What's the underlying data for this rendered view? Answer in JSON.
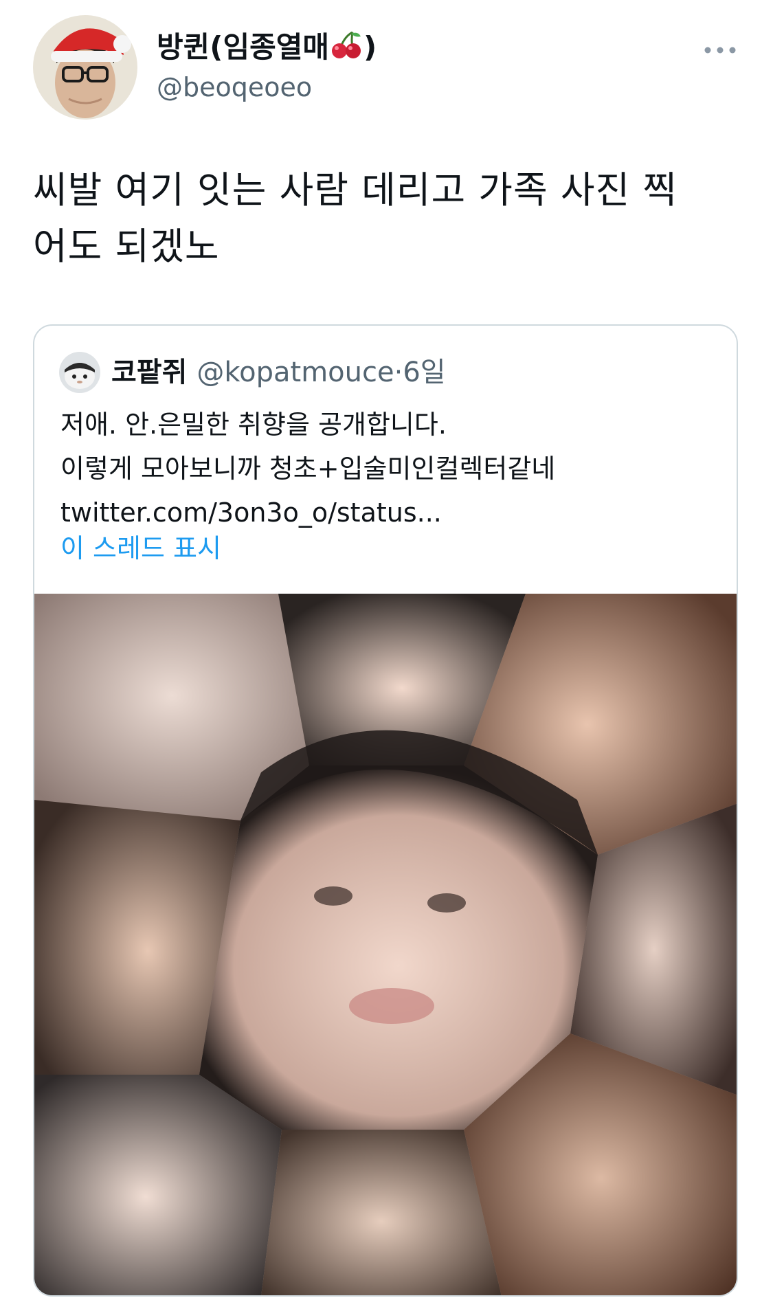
{
  "author": {
    "display_name_prefix": "방퀸(임종열매",
    "display_name_suffix": ")",
    "name_emoji": "cherries",
    "handle": "@beoqeoeo",
    "avatar": "avatar-with-santa-hat"
  },
  "menu_icon": "more-dots-icon",
  "tweet": {
    "lines": [
      "씨발 여기 잇는 사람 데리고 가족 사진 찍",
      "어도 되겠노"
    ]
  },
  "quote": {
    "name": "코팥쥐",
    "handle": "@kopatmouce",
    "dot": "·",
    "time": "6일",
    "lines": [
      "저애. 안.은밀한 취향을 공개합니다.",
      "이렇게 모아보니까 청초+입술미인컬렉터같네",
      "twitter.com/3on3o_o/status..."
    ],
    "show_thread": "이 스레드 표시",
    "media": "photo-collage"
  },
  "colors": {
    "text": "#0f1419",
    "secondary": "#536471",
    "link": "#1d9bf0",
    "border": "#cfd9de"
  }
}
